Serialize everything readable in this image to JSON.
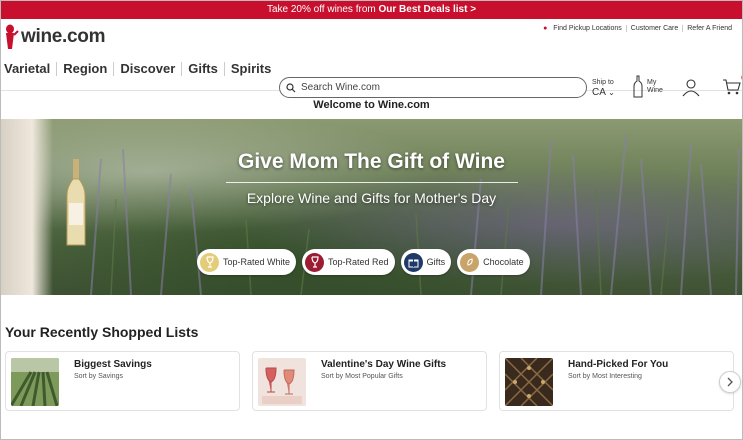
{
  "promo": {
    "text": "Take 20% off wines from ",
    "link": "Our Best Deals list >"
  },
  "brand": {
    "logo": "wine.com",
    "accent": "#c8102e"
  },
  "utility_links": [
    "Find Pickup Locations",
    "Customer Care",
    "Refer A Friend"
  ],
  "nav": [
    "Varietal",
    "Region",
    "Discover",
    "Gifts",
    "Spirits"
  ],
  "search": {
    "placeholder": "Search Wine.com"
  },
  "ship_to": {
    "label": "Ship to",
    "state": "CA"
  },
  "my_wine": {
    "label_line1": "My",
    "label_line2": "Wine"
  },
  "cart": {
    "count": "0"
  },
  "welcome": "Welcome to Wine.com",
  "hero": {
    "title": "Give Mom The Gift of Wine",
    "subtitle": "Explore Wine and Gifts for Mother's Day",
    "pills": [
      {
        "label": "Top-Rated White",
        "icon": "white-wine-glass-icon",
        "color": "#e3cc7a"
      },
      {
        "label": "Top-Rated Red",
        "icon": "red-wine-glass-icon",
        "color": "#9c1c33"
      },
      {
        "label": "Gifts",
        "icon": "gift-icon",
        "color": "#1f3a68"
      },
      {
        "label": "Chocolate",
        "icon": "chocolate-icon",
        "color": "#c9a46a"
      }
    ]
  },
  "recent": {
    "title": "Your Recently Shopped Lists",
    "cards": [
      {
        "title": "Biggest Savings",
        "subtitle": "Sort by Savings"
      },
      {
        "title": "Valentine's Day Wine Gifts",
        "subtitle": "Sort by Most Popular Gifts"
      },
      {
        "title": "Hand-Picked For You",
        "subtitle": "Sort by Most Interesting"
      }
    ]
  }
}
